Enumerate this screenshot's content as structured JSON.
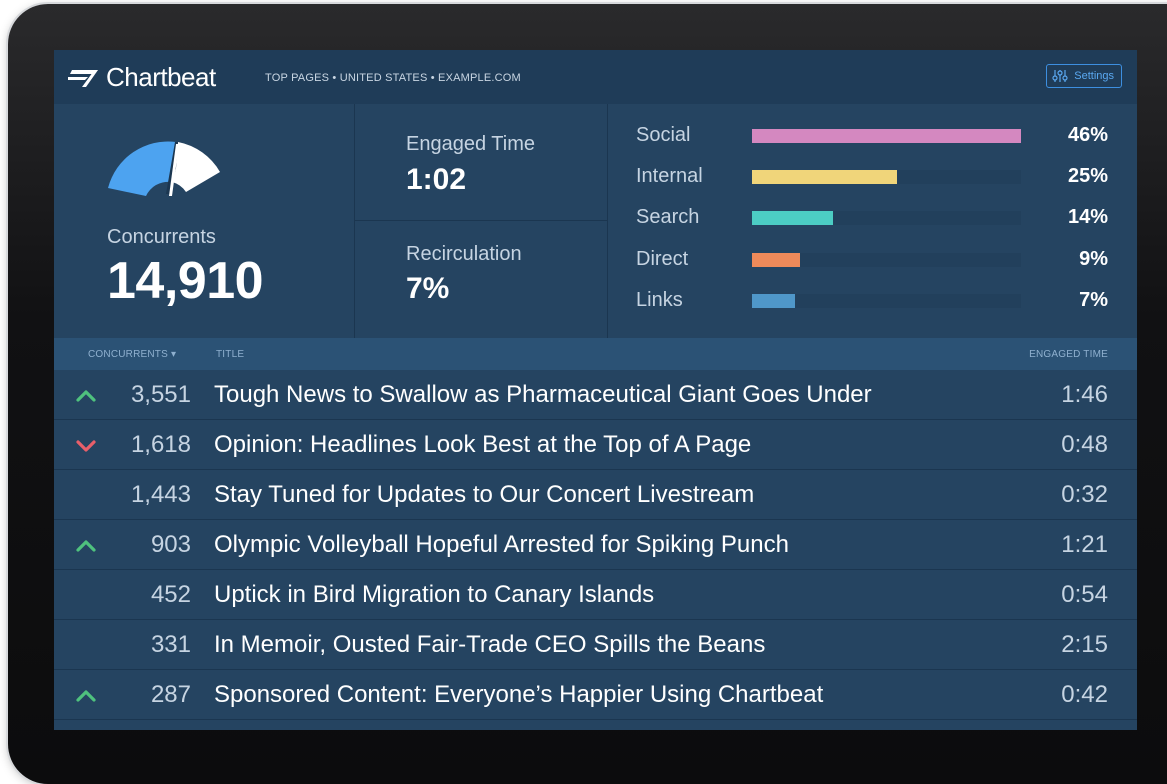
{
  "header": {
    "brand": "Chartbeat",
    "breadcrumb": "TOP PAGES • UNITED STATES • EXAMPLE.COM",
    "settings_label": "Settings"
  },
  "stats": {
    "concurrents": {
      "label": "Concurrents",
      "value": "14,910"
    },
    "engaged_time": {
      "label": "Engaged Time",
      "value": "1:02"
    },
    "recirculation": {
      "label": "Recirculation",
      "value": "7%"
    }
  },
  "traffic_sources": [
    {
      "label": "Social",
      "percent": "46%",
      "fraction": 1.0,
      "color": "#d488c0"
    },
    {
      "label": "Internal",
      "percent": "25%",
      "fraction": 0.54,
      "color": "#f0d57a"
    },
    {
      "label": "Search",
      "percent": "14%",
      "fraction": 0.3,
      "color": "#4ccdc4"
    },
    {
      "label": "Direct",
      "percent": "9%",
      "fraction": 0.18,
      "color": "#ee8a5a"
    },
    {
      "label": "Links",
      "percent": "7%",
      "fraction": 0.16,
      "color": "#4f97c9"
    }
  ],
  "table": {
    "col_concurrents": "CONCURRENTS ▾",
    "col_title": "TITLE",
    "col_engaged": "ENGAGED TIME",
    "rows": [
      {
        "trend": "up",
        "concurrents": "3,551",
        "title": "Tough News to Swallow as Pharmaceutical Giant Goes Under",
        "engaged_time": "1:46"
      },
      {
        "trend": "down",
        "concurrents": "1,618",
        "title": "Opinion: Headlines Look Best at the Top of A Page",
        "engaged_time": "0:48"
      },
      {
        "trend": "none",
        "concurrents": "1,443",
        "title": "Stay Tuned for Updates to Our Concert Livestream",
        "engaged_time": "0:32"
      },
      {
        "trend": "up",
        "concurrents": "903",
        "title": "Olympic Volleyball Hopeful Arrested for Spiking Punch",
        "engaged_time": "1:21"
      },
      {
        "trend": "none",
        "concurrents": "452",
        "title": "Uptick in Bird Migration to Canary Islands",
        "engaged_time": "0:54"
      },
      {
        "trend": "none",
        "concurrents": "331",
        "title": "In Memoir, Ousted Fair-Trade CEO Spills the Beans",
        "engaged_time": "2:15"
      },
      {
        "trend": "up",
        "concurrents": "287",
        "title": "Sponsored Content: Everyone’s Happier Using Chartbeat",
        "engaged_time": "0:42"
      }
    ]
  },
  "colors": {
    "up_arrow": "#4fc27e",
    "down_arrow": "#e85f6a",
    "gauge_blue": "#4da3f0",
    "gauge_white": "#ffffff",
    "accent": "#3d8fe0"
  }
}
